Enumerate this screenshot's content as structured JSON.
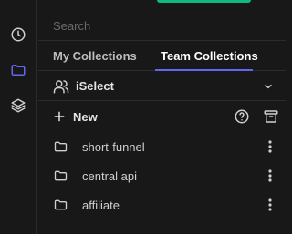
{
  "search": {
    "placeholder": "Search"
  },
  "tabs": [
    {
      "label": "My Collections"
    },
    {
      "label": "Team Collections",
      "active": true
    }
  ],
  "workspace": {
    "name": "iSelect"
  },
  "actions": {
    "new_label": "New"
  },
  "collections": [
    {
      "name": "short-funnel"
    },
    {
      "name": "central api"
    },
    {
      "name": "affiliate"
    }
  ],
  "icons": {
    "rail": [
      "clock-icon",
      "folder-icon",
      "layers-icon"
    ],
    "workspace": "users-icon",
    "new": "plus-icon",
    "help": "help-circle-icon",
    "archive": "archive-icon",
    "row_folder": "folder-icon",
    "row_more": "more-vertical-icon"
  },
  "colors": {
    "accent_green": "#10b981",
    "tab_indicator": "#6366f1",
    "active_rail_icon": "#6366f1",
    "background": "#181818"
  }
}
